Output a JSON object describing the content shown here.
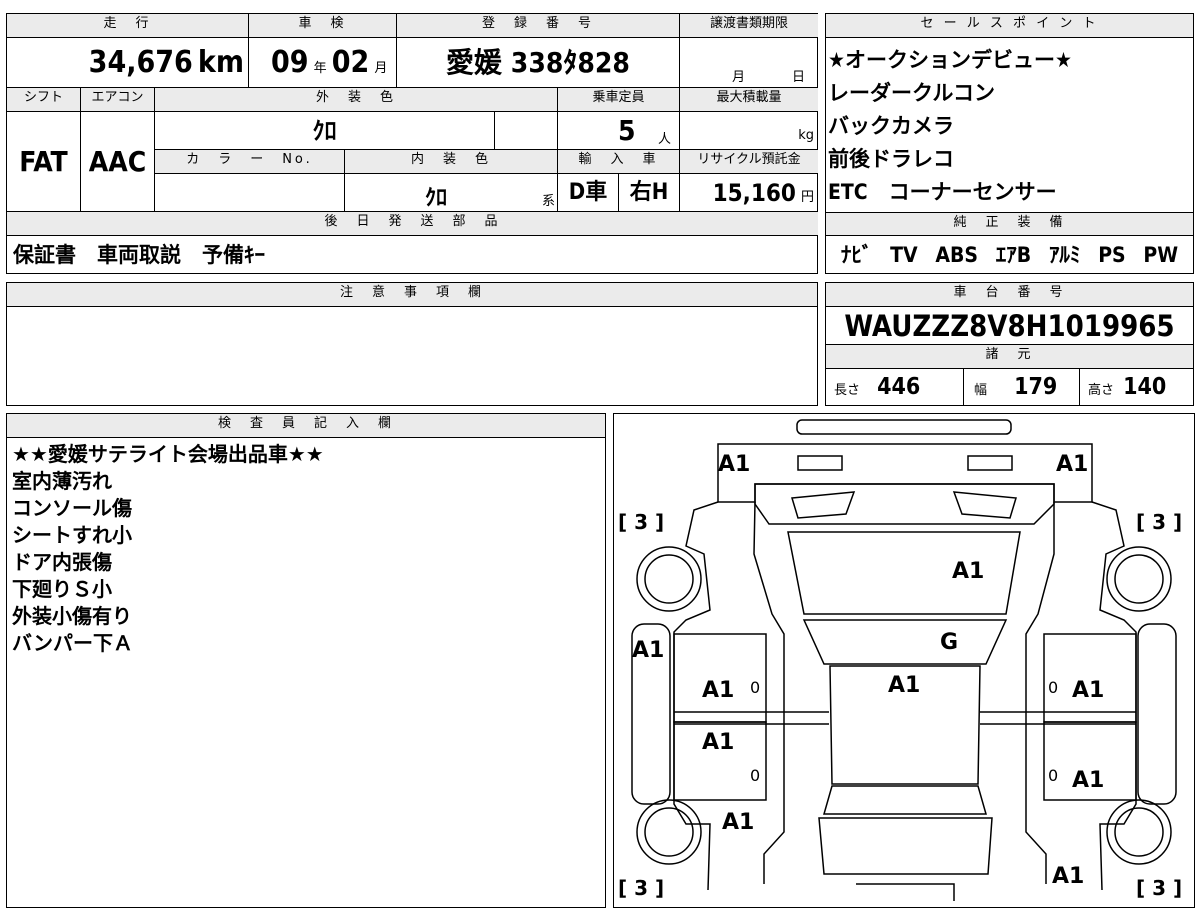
{
  "vehicle": {
    "mileage": {
      "header": "走　行",
      "value": "34,676",
      "unit": "km"
    },
    "inspection": {
      "header": "車　検",
      "year": "09",
      "year_unit": "年",
      "month": "02",
      "month_unit": "月"
    },
    "registration": {
      "header": "登　録　番　号",
      "value": "愛媛 338ﾀ828"
    },
    "transfer": {
      "header": "譲渡書類期限",
      "month_unit": "月",
      "day_unit": "日"
    },
    "shift": {
      "header": "シフト",
      "value": "FAT"
    },
    "aircon": {
      "header": "エアコン",
      "value": "AAC"
    },
    "exterior_color": {
      "header": "外　装　色",
      "value": "ｸﾛ"
    },
    "capacity": {
      "header": "乗車定員",
      "value": "5",
      "unit": "人"
    },
    "max_load": {
      "header": "最大積載量",
      "unit": "kg"
    },
    "color_no": {
      "header": "カ　ラ　ー　No."
    },
    "interior_color": {
      "header": "内　装　色",
      "value": "ｸﾛ",
      "unit": "系"
    },
    "import": {
      "header": "輸　入　車",
      "drive_type": "D車",
      "steering": "右H"
    },
    "recycle": {
      "header": "リサイクル預託金",
      "value": "15,160",
      "unit": "円"
    },
    "later_parts": {
      "header": "後　日　発　送　部　品",
      "value": "保証書　車両取説　予備ｷｰ"
    }
  },
  "sales_points": {
    "header": "セ ー ル ス ポ イ ン ト",
    "items": [
      "★オークションデビュー★",
      "レーダークルコン",
      "バックカメラ",
      "前後ドラレコ",
      "ETC　コーナーセンサー"
    ]
  },
  "factory_equipment": {
    "header": "純　正　装　備",
    "items": [
      "ﾅﾋﾞ",
      "TV",
      "ABS",
      "ｴｱB",
      "ｱﾙﾐ",
      "PS",
      "PW"
    ]
  },
  "caution": {
    "header": "注　意　事　項　欄",
    "value": ""
  },
  "chassis": {
    "header": "車　台　番　号",
    "value": "WAUZZZ8V8H1019965"
  },
  "specs": {
    "header": "諸　元",
    "length_label": "長さ",
    "length": "446",
    "width_label": "幅",
    "width": "179",
    "height_label": "高さ",
    "height": "140"
  },
  "inspector": {
    "header": "検　査　員　記　入　欄",
    "notes": [
      "★★愛媛サテライト会場出品車★★",
      "室内薄汚れ",
      "コンソール傷",
      "シートすれ小",
      "ドア内張傷",
      "下廻りＳ小",
      "外装小傷有り",
      "バンパー下Ａ"
    ]
  },
  "diagram": {
    "labels": [
      "A1",
      "A1",
      "A1",
      "G",
      "A1",
      "A1",
      "A1",
      "A1",
      "A1",
      "A1",
      "A1",
      "A1"
    ],
    "tires": [
      "[ 3 ]",
      "[ 3 ]",
      "[ 3 ]",
      "[ 3 ]"
    ],
    "zeros": [
      "0",
      "0",
      "0",
      "0"
    ]
  }
}
